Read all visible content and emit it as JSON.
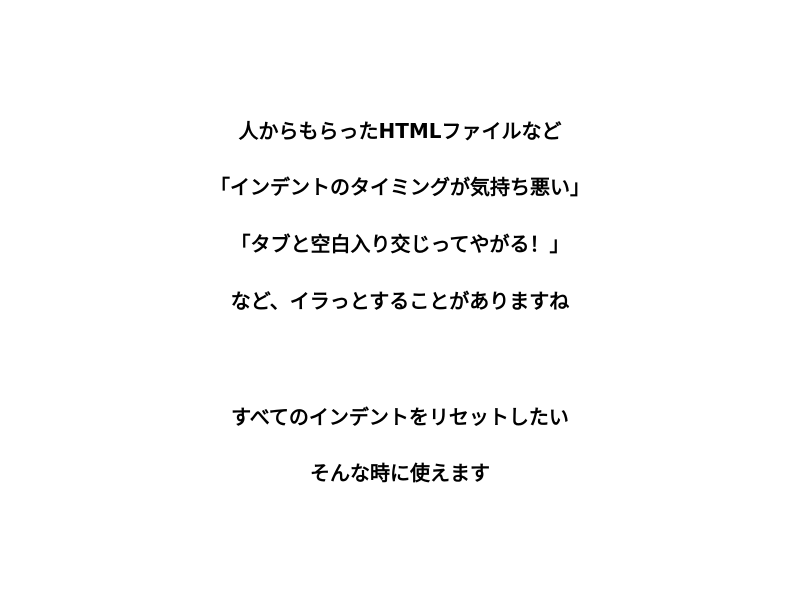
{
  "slide": {
    "paragraphs": [
      {
        "lines": [
          "人からもらったHTMLファイルなど",
          "「インデントのタイミングが気持ち悪い」",
          "「タブと空白入り交じってやがる！」",
          "など、イラっとすることがありますね"
        ]
      },
      {
        "lines": [
          "すべてのインデントをリセットしたい",
          "そんな時に使えます"
        ]
      }
    ],
    "colors": {
      "background": "#ffffff",
      "text": "#000000"
    }
  }
}
